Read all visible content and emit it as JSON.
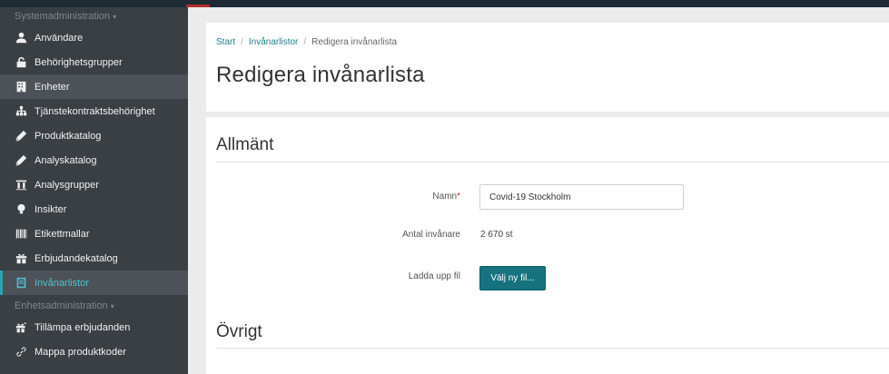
{
  "sidebar": {
    "system_section": "Systemadministration",
    "system_items": [
      {
        "label": "Användare",
        "icon": "user-icon"
      },
      {
        "label": "Behörighetsgrupper",
        "icon": "lock-icon"
      },
      {
        "label": "Enheter",
        "icon": "building-icon"
      },
      {
        "label": "Tjänstekontraktsbehörighet",
        "icon": "sitemap-icon"
      },
      {
        "label": "Produktkatalog",
        "icon": "pencil-icon"
      },
      {
        "label": "Analyskatalog",
        "icon": "pencil-icon"
      },
      {
        "label": "Analysgrupper",
        "icon": "columns-icon"
      },
      {
        "label": "Insikter",
        "icon": "lightbulb-icon"
      },
      {
        "label": "Etikettmallar",
        "icon": "barcode-icon"
      },
      {
        "label": "Erbjudandekatalog",
        "icon": "gift-icon"
      },
      {
        "label": "Invånarlistor",
        "icon": "list-icon"
      }
    ],
    "unit_section": "Enhetsadministration",
    "unit_items": [
      {
        "label": "Tillämpa erbjudanden",
        "icon": "gift-apply-icon"
      },
      {
        "label": "Mappa produktkoder",
        "icon": "link-icon"
      }
    ]
  },
  "breadcrumb": {
    "start": "Start",
    "lists": "Invånarlistor",
    "current": "Redigera invånarlista"
  },
  "page_title": "Redigera invånarlista",
  "form": {
    "section_general": "Allmänt",
    "name_label": "Namn",
    "name_required_mark": "*",
    "name_value": "Covid-19 Stockholm",
    "count_label": "Antal invånare",
    "count_value": "2 670 st",
    "upload_label": "Ladda upp fil",
    "upload_button": "Välj ny fil...",
    "section_other": "Övrigt"
  },
  "colors": {
    "sidebar_bg": "#3a3f44",
    "active_accent": "#28a7b3",
    "button_primary": "#16727f",
    "link": "#1d7f8c"
  }
}
